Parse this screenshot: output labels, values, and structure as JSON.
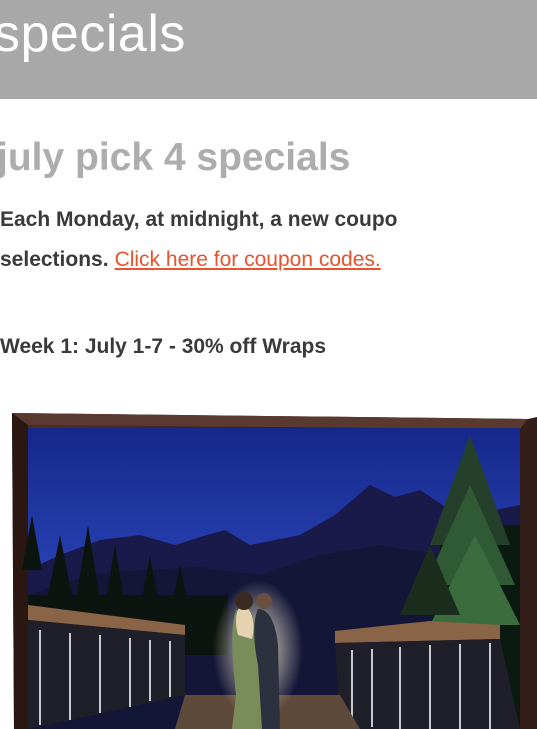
{
  "header": {
    "title": "specials"
  },
  "section": {
    "title": "july pick 4 specials"
  },
  "intro": {
    "line1": "Each Monday, at midnight, a new coupo",
    "line2": "selections.",
    "link_text": "Click here for coupon codes."
  },
  "week": {
    "heading": "Week 1: July 1-7 - 30% off Wraps"
  },
  "colors": {
    "header_band": "#a8a8a8",
    "section_title": "#adadad",
    "body_text": "#3a3a3a",
    "link": "#e8522c",
    "frame": "#3b2620",
    "sky": "#1c2f96"
  }
}
